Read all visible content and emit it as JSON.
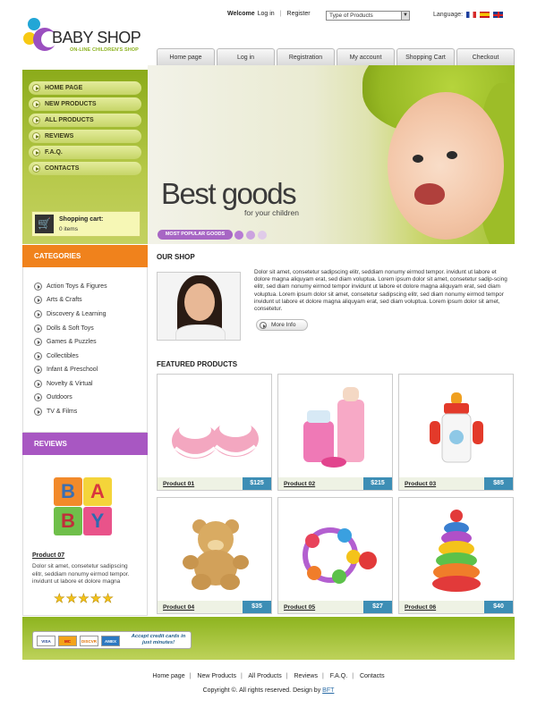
{
  "logo": {
    "title": "BABY SHOP",
    "subtitle": "ON-LINE CHILDREN'S SHOP"
  },
  "topbar": {
    "welcome": "Welcome",
    "login": "Log in",
    "register": "Register",
    "type_select_value": "Type of Products",
    "language_label": "Language:"
  },
  "nav": [
    "Home page",
    "Log in",
    "Registration",
    "My account",
    "Shopping Cart",
    "Checkout"
  ],
  "menu": [
    "HOME PAGE",
    "NEW PRODUCTS",
    "ALL PRODUCTS",
    "REVIEWS",
    "F.A.Q.",
    "CONTACTS"
  ],
  "cart": {
    "title": "Shopping cart:",
    "items": "0 items"
  },
  "hero": {
    "title": "Best goods",
    "subtitle": "for your children",
    "badge": "MOST POPULAR GOODS"
  },
  "categories": {
    "title": "CATEGORIES",
    "items": [
      "Action Toys & Figures",
      "Arts & Crafts",
      "Discovery & Learning",
      "Dolls & Soft Toys",
      "Games & Puzzles",
      "Collectibles",
      "Infant & Preschool",
      "Novelty & Virtual",
      "Outdoors",
      "TV & Films"
    ]
  },
  "reviews": {
    "title": "REVIEWS",
    "blocks": [
      "B",
      "A",
      "B",
      "Y"
    ],
    "product": "Product 07",
    "text": "Dolor sit amet, consetetur sadipscing elitr, seddiam nonumy eirmod tempor. invidunt ut labore et dolore magna",
    "rating": 5
  },
  "shop": {
    "title": "OUR SHOP",
    "text": "Dolor sit amet, consetetur sadipscing elitr, seddiam nonumy eirmod tempor. invidunt ut labore et dolore magna aliquyam erat, sed diam voluptua. Lorem ipsum dolor sit amet, consetetur sadip-scing elitr, sed diam nonumy eirmod tempor invidunt ut labore et dolore magna aliquyam erat, sed diam voluptua. Lorem ipsum dolor sit amet, consetetur sadipscing elitr, sed diam nonumy eirmod tempor invidunt ut labore et dolore magna aliquyam erat, sed diam voluptua. Lorem ipsum dolor sit amet, consetetur.",
    "more": "More Info"
  },
  "featured": {
    "title": "FEATURED PRODUCTS",
    "products": [
      {
        "name": "Product 01",
        "price": "$125"
      },
      {
        "name": "Product 02",
        "price": "$215"
      },
      {
        "name": "Product 03",
        "price": "$85"
      },
      {
        "name": "Product 04",
        "price": "$35"
      },
      {
        "name": "Product 05",
        "price": "$27"
      },
      {
        "name": "Product 06",
        "price": "$40"
      }
    ]
  },
  "payment": {
    "cards": [
      "VISA",
      "MC",
      "DISCVR",
      "AMEX"
    ],
    "text": "Accept credit cards in just minutes!"
  },
  "footer": {
    "links": [
      "Home page",
      "New Products",
      "All Products",
      "Reviews",
      "F.A.Q.",
      "Contacts"
    ],
    "copyright": "Copyright ©. All rights reserved. Design by",
    "design_link": "BFT"
  },
  "colors": {
    "green": "#8db41f",
    "orange": "#f0821c",
    "purple": "#a857c2",
    "price_blue": "#3d8eb5"
  }
}
